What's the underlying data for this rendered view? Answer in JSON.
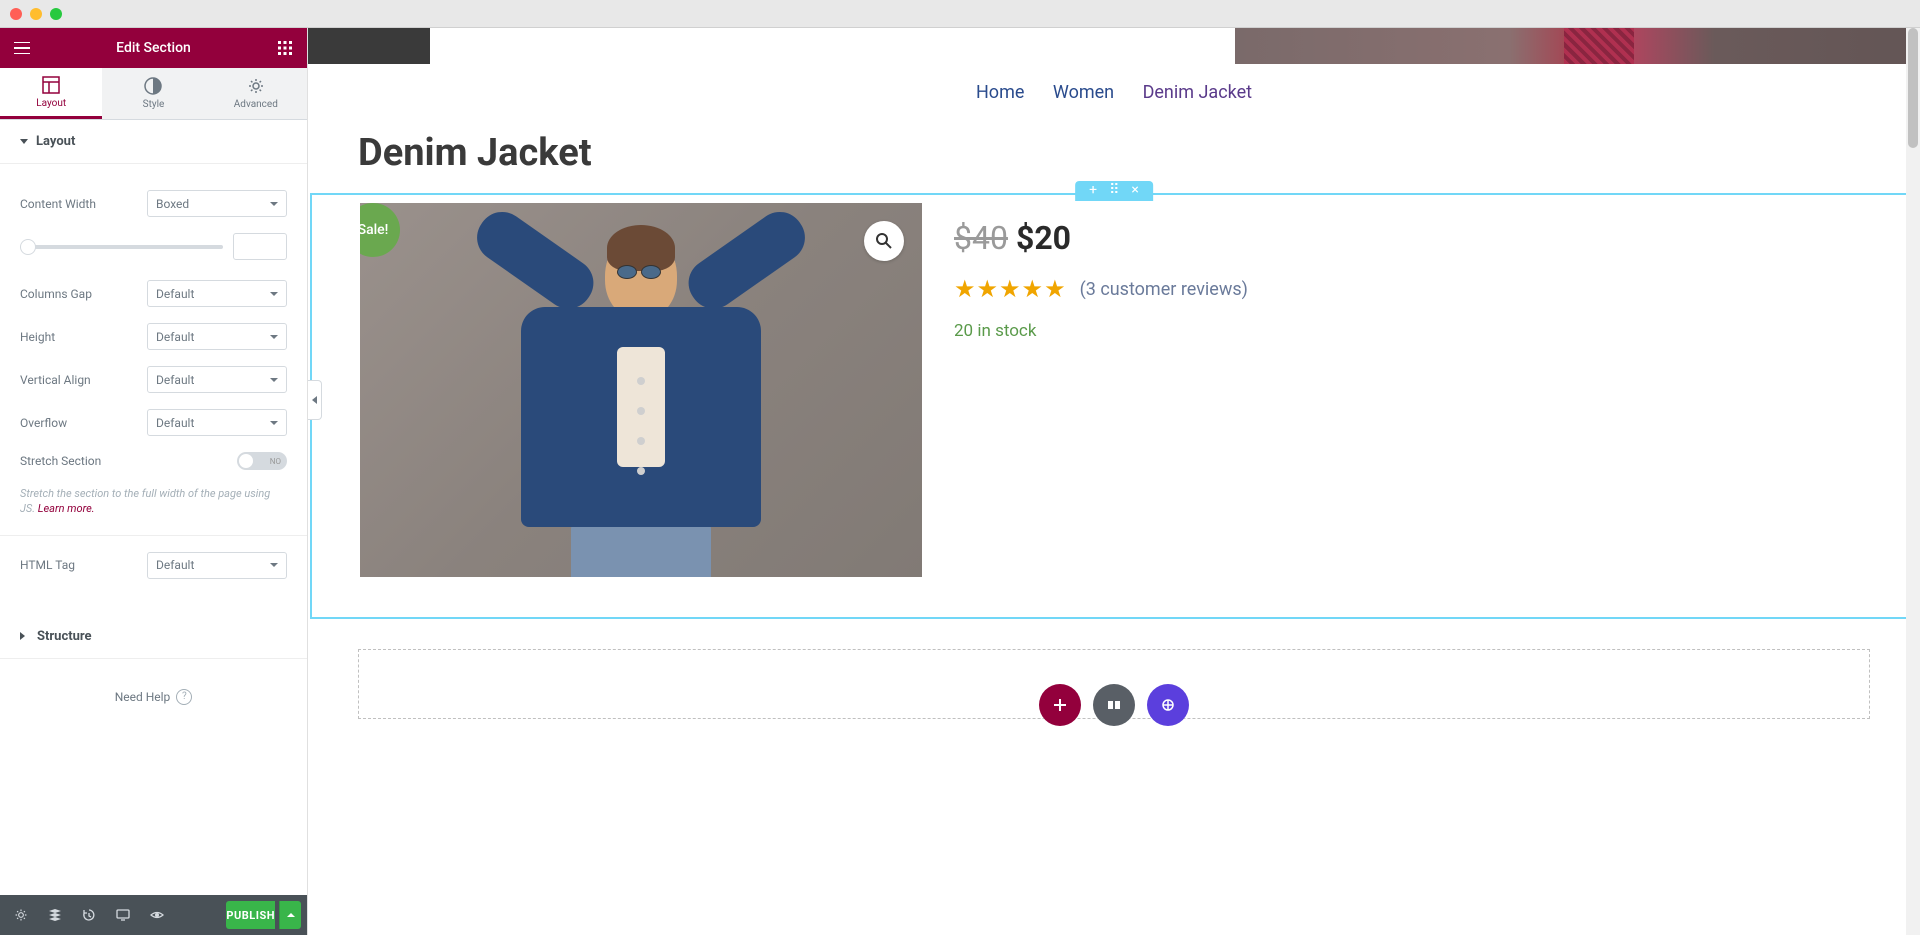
{
  "sidebar": {
    "title": "Edit Section",
    "tabs": {
      "layout": "Layout",
      "style": "Style",
      "advanced": "Advanced"
    },
    "section": "Layout",
    "structure": "Structure",
    "controls": {
      "contentWidth": {
        "label": "Content Width",
        "value": "Boxed"
      },
      "columnsGap": {
        "label": "Columns Gap",
        "value": "Default"
      },
      "height": {
        "label": "Height",
        "value": "Default"
      },
      "verticalAlign": {
        "label": "Vertical Align",
        "value": "Default"
      },
      "overflow": {
        "label": "Overflow",
        "value": "Default"
      },
      "stretch": {
        "label": "Stretch Section",
        "value": "NO"
      },
      "htmlTag": {
        "label": "HTML Tag",
        "value": "Default"
      }
    },
    "stretchHelp": "Stretch the section to the full width of the page using JS. ",
    "learnMore": "Learn more.",
    "needHelp": "Need Help",
    "publish": "PUBLISH"
  },
  "preview": {
    "breadcrumb": {
      "home": "Home",
      "women": "Women",
      "current": "Denim Jacket"
    },
    "productTitle": "Denim Jacket",
    "saleBadge": "Sale!",
    "price": {
      "old": "$40",
      "new": "$20"
    },
    "reviews": "(3 customer reviews)",
    "stock": "20 in stock"
  }
}
